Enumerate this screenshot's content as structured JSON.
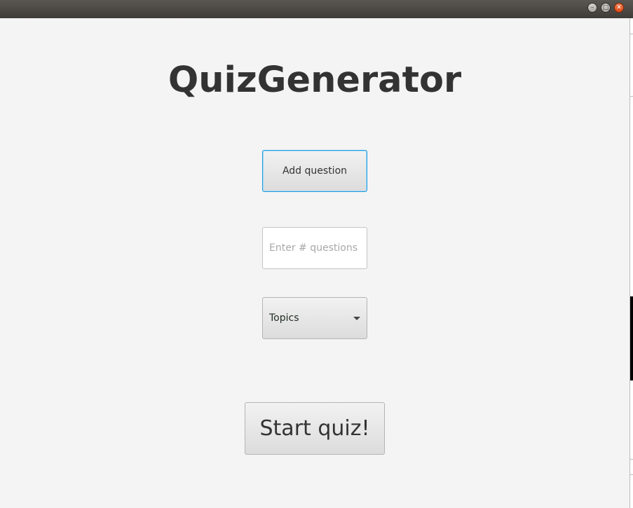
{
  "window": {
    "minimize_glyph": "–",
    "maximize_glyph": "□",
    "close_glyph": "✕"
  },
  "app": {
    "title": "QuizGenerator"
  },
  "controls": {
    "add_question_label": "Add question",
    "num_questions_placeholder": "Enter # questions",
    "num_questions_value": "",
    "topics_selected": "Topics",
    "start_label": "Start quiz!"
  },
  "icons": {
    "dropdown": "chevron-down-icon",
    "minimize": "minimize-icon",
    "maximize": "maximize-icon",
    "close": "close-icon"
  },
  "colors": {
    "background": "#f4f4f4",
    "focus_border": "#1e9be0",
    "close_button": "#df4a16",
    "title_text": "#333333"
  }
}
